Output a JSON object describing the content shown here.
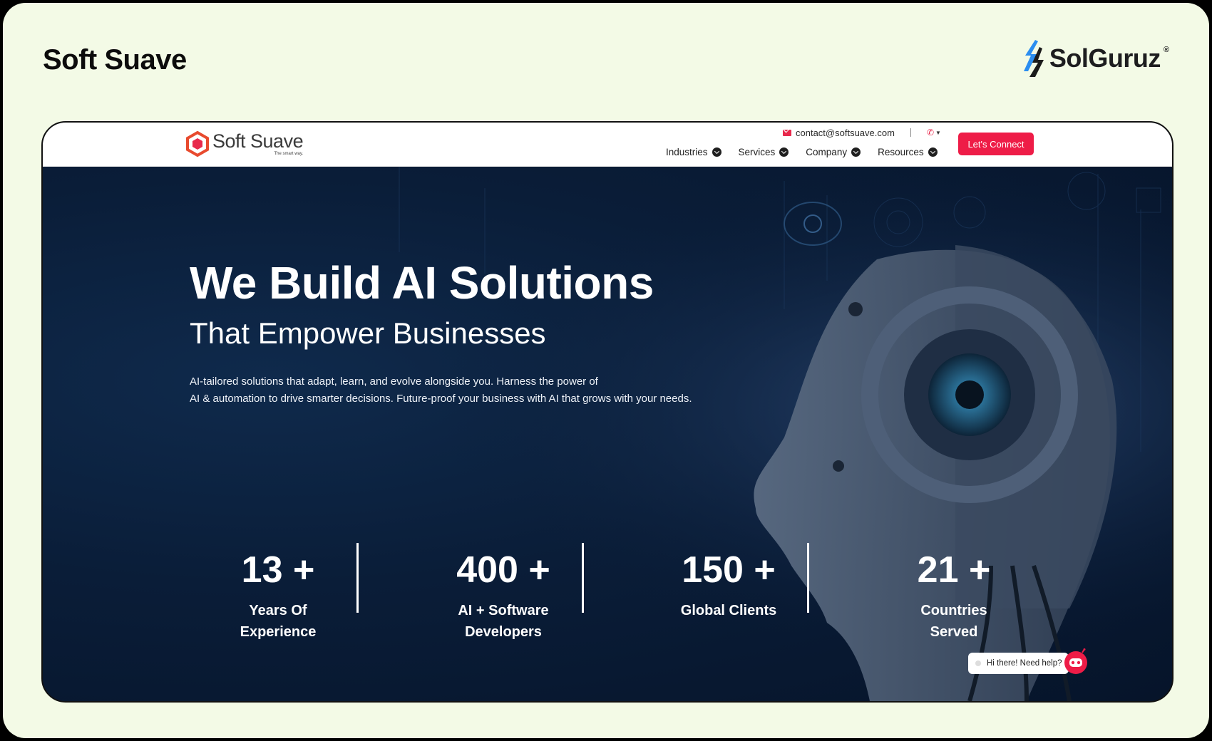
{
  "page": {
    "title": "Soft Suave",
    "brand": "SolGuruz",
    "brand_reg": "®"
  },
  "site": {
    "logo_name": "Soft Suave",
    "logo_tagline": "The smart way.",
    "contact_email": "contact@softsuave.com",
    "nav": [
      {
        "label": "Industries"
      },
      {
        "label": "Services"
      },
      {
        "label": "Company"
      },
      {
        "label": "Resources"
      }
    ],
    "cta_label": "Let's Connect",
    "accent_color": "#ee1c47"
  },
  "hero": {
    "headline": "We Build AI Solutions",
    "subheadline": "That Empower Businesses",
    "description_line1": "AI-tailored solutions that adapt, learn, and evolve alongside you. Harness the power of",
    "description_line2": "AI & automation to drive smarter decisions. Future-proof your business with AI that grows with your needs.",
    "stats": [
      {
        "value": "13 +",
        "label_line1": "Years Of",
        "label_line2": "Experience"
      },
      {
        "value": "400 +",
        "label_line1": "AI + Software",
        "label_line2": "Developers"
      },
      {
        "value": "150 +",
        "label_line1": "Global Clients",
        "label_line2": ""
      },
      {
        "value": "21 +",
        "label_line1": "Countries",
        "label_line2": "Served"
      }
    ]
  },
  "chat": {
    "prompt": "Hi there! Need help?"
  }
}
